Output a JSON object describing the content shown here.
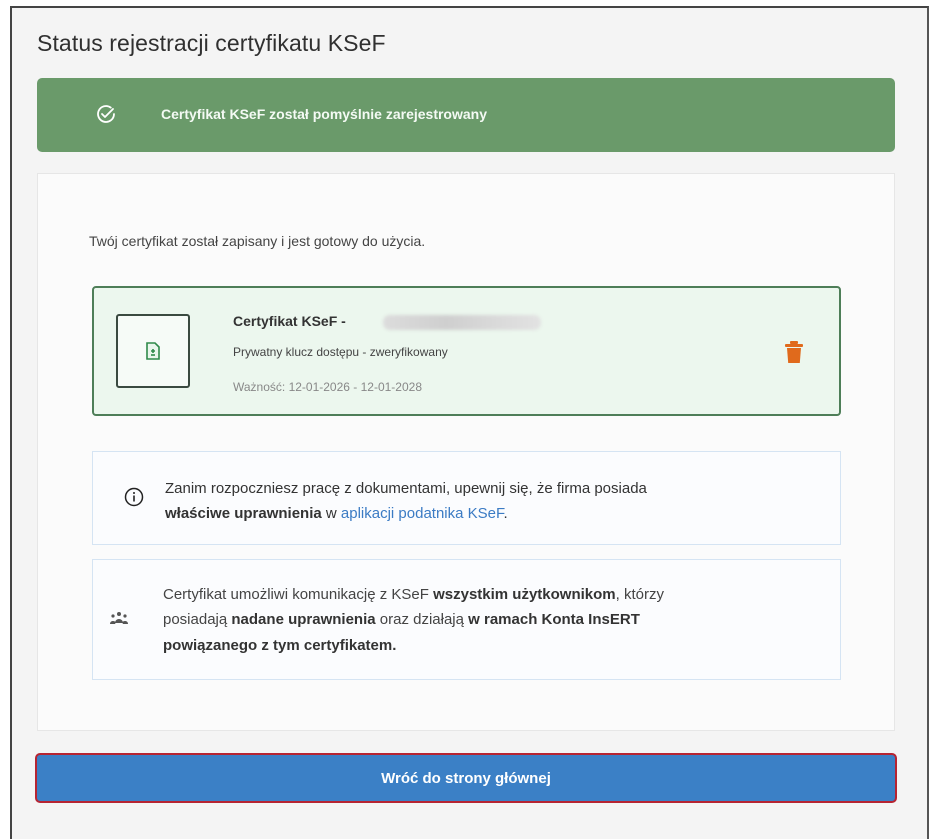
{
  "page": {
    "title": "Status rejestracji certyfikatu KSeF"
  },
  "banner": {
    "message": "Certyfikat KSeF został pomyślnie zarejestrowany",
    "icon": "check-circle-icon",
    "color": "#6a9a6a"
  },
  "main": {
    "lead": "Twój certyfikat został zapisany i jest gotowy do użycia."
  },
  "certificate": {
    "name": "Certyfikat KSeF -",
    "key_status": "Prywatny klucz dostępu - zweryfikowany",
    "validity": "Ważność: 12-01-2026 - 12-01-2028",
    "icon": "certificate-file-icon",
    "delete_icon": "trash-icon",
    "delete_color": "#e06a1c"
  },
  "info": {
    "text_before": "Zanim rozpoczniesz pracę z dokumentami, upewnij się, że firma posiada",
    "bold": "właściwe uprawnienia",
    "middle": " w ",
    "link": "aplikacji podatnika KSeF",
    "end": ".",
    "icon": "info-icon"
  },
  "users_note": {
    "l1_a": "Certyfikat umożliwi komunikację z KSeF ",
    "l1_b": "wszystkim użytkownikom",
    "l1_c": ", którzy",
    "l2_a": "posiadają ",
    "l2_b": "nadane uprawnienia",
    "l2_c": " oraz działają ",
    "l2_d": "w ramach Konta InsERT",
    "l3": "powiązanego z tym certyfikatem.",
    "icon": "users-icon"
  },
  "actions": {
    "back_label": "Wróć do strony głównej",
    "button_color": "#3b80c6"
  }
}
